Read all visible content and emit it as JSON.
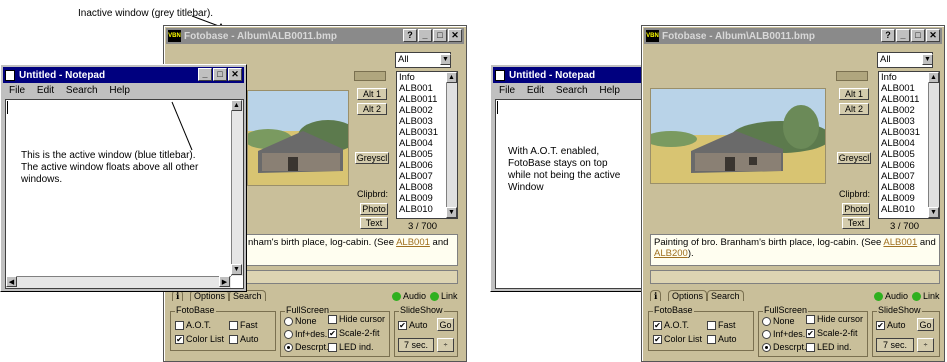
{
  "captions": {
    "inactive_window": "Inactive window (grey titlebar).",
    "active_window": "This is the active window (blue titlebar).\nThe active window floats above all other windows.",
    "aot": "With A.O.T. enabled,\nFotoBase stays on top\nwhile not being the active\nWindow"
  },
  "fotobase": {
    "title": "Fotobase - Album\\ALB0011.bmp",
    "combo_value": "All",
    "list_items": [
      "Info",
      "ALB001",
      "ALB0011",
      "ALB002",
      "ALB003",
      "ALB0031",
      "ALB004",
      "ALB005",
      "ALB006",
      "ALB007",
      "ALB008",
      "ALB009",
      "ALB010"
    ],
    "buttons": {
      "alt1": "Alt 1",
      "alt2": "Alt 2",
      "greyscl": "Greyscl",
      "clipbrd": "Clipbrd:",
      "photo": "Photo",
      "text": "Text"
    },
    "counter": "3 / 700",
    "desc_text_full": "Painting of bro. Branham's birth place, log-cabin. (See ",
    "desc_text_partial": "nham's birth place, log-cabin. (See ",
    "desc_link1": "ALB001",
    "desc_and": " and",
    "desc_link2": "ALB200",
    "desc_end": ").",
    "tabs": [
      "Options",
      "Search"
    ],
    "status": {
      "audio": "Audio",
      "link": "Link"
    },
    "groups": {
      "fotobase": {
        "title": "FotoBase",
        "aot": "A.O.T.",
        "fast": "Fast",
        "color_list": "Color List",
        "auto": "Auto"
      },
      "fullscreen": {
        "title": "FullScreen",
        "none": "None",
        "info_des": "Inf+des.",
        "descript": "Descrpt.",
        "hide_cursor": "Hide cursor",
        "scale": "Scale-2-fit",
        "led": "LED ind."
      },
      "slideshow": {
        "title": "SlideShow",
        "auto": "Auto",
        "go": "Go",
        "seconds": "7 sec."
      }
    }
  },
  "notepad": {
    "title": "Untitled - Notepad",
    "menu": [
      "File",
      "Edit",
      "Search",
      "Help"
    ]
  },
  "colors": {
    "active_title": "#00007f",
    "inactive_title": "#8a8a8a",
    "link": "#a07020"
  }
}
